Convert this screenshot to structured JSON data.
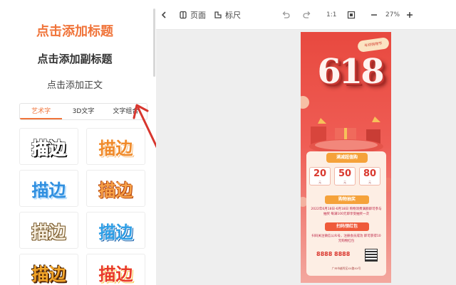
{
  "left_panel": {
    "add_heading": "点击添加标题",
    "add_subheading": "点击添加副标题",
    "add_body": "点击添加正文",
    "tabs": [
      {
        "label": "艺术字",
        "active": true
      },
      {
        "label": "3D文字",
        "active": false
      },
      {
        "label": "文字组合",
        "active": false
      }
    ],
    "style_cards": [
      {
        "text": "描边"
      },
      {
        "text": "描边"
      },
      {
        "text": "描边"
      },
      {
        "text": "描边"
      },
      {
        "text": "描边"
      },
      {
        "text": "描边"
      },
      {
        "text": "描边"
      },
      {
        "text": "描边"
      }
    ]
  },
  "toolbar": {
    "back_icon": "chevron-left-icon",
    "page_label": "页面",
    "ruler_label": "标尺",
    "ratio_label": "1:1",
    "zoom_value": "27%",
    "zoom_out_icon": "minus-icon",
    "zoom_in_icon": "plus-icon"
  },
  "poster": {
    "badge": "年终购物节",
    "headline": "618",
    "card_title": "满减超值购",
    "coupons": [
      {
        "value": "20",
        "unit": "元"
      },
      {
        "value": "50",
        "unit": "元"
      },
      {
        "value": "80",
        "unit": "元"
      }
    ],
    "lottery_title": "购物抽奖",
    "lottery_text": "2022年6月18日-6月18日 购物消费满额即可参与抽奖 每满100元即享受抽奖一次",
    "redpack_title": "扫码领红包",
    "redpack_text": "扫码关注微信公众号，注册会员成功 即可获得10元购物红包",
    "phone": "8888 8888",
    "address": "广州市越秀区XX路XX号"
  },
  "colors": {
    "accent": "#f0743a",
    "canvas_bg": "#eeeeee",
    "poster_red": "#e8493f",
    "arrow_red": "#d8362e"
  }
}
